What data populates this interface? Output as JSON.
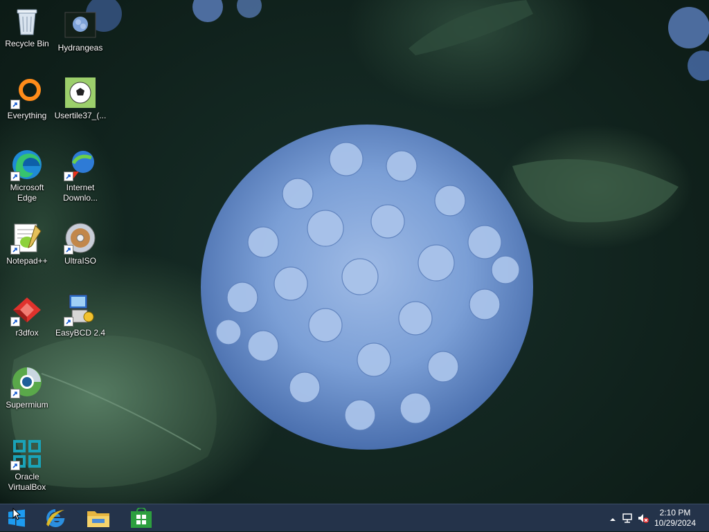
{
  "desktop": {
    "icons": [
      {
        "label": "Recycle Bin",
        "icon": "recycle-bin-icon"
      },
      {
        "label": "Hydrangeas",
        "icon": "image-file-icon"
      },
      {
        "label": "Everything",
        "icon": "everything-search-icon"
      },
      {
        "label": "Usertile37_(...",
        "icon": "soccer-ball-image-icon"
      },
      {
        "label": "Microsoft Edge",
        "icon": "edge-icon"
      },
      {
        "label": "Internet Downlo...",
        "icon": "internet-download-manager-icon"
      },
      {
        "label": "Notepad++",
        "icon": "notepad-plus-plus-icon"
      },
      {
        "label": "UltraISO",
        "icon": "disc-icon"
      },
      {
        "label": "r3dfox",
        "icon": "r3dfox-icon"
      },
      {
        "label": "EasyBCD 2.4",
        "icon": "easybcd-icon"
      },
      {
        "label": "Supermium",
        "icon": "supermium-icon"
      },
      {
        "label": "Oracle VirtualBox",
        "icon": "virtualbox-icon"
      }
    ]
  },
  "taskbar": {
    "pinned": [
      {
        "name": "start-button",
        "icon": "windows-logo-icon"
      },
      {
        "name": "internet-explorer",
        "icon": "internet-explorer-icon"
      },
      {
        "name": "file-explorer",
        "icon": "folder-icon"
      },
      {
        "name": "windows-store",
        "icon": "store-icon"
      }
    ],
    "tray": {
      "icons": [
        "show-hidden-icons-icon",
        "network-icon",
        "volume-muted-icon"
      ],
      "time": "2:10 PM",
      "date": "10/29/2024"
    }
  },
  "colors": {
    "taskbar": "#24334a",
    "store": "#2d9f3f",
    "hydrangea": "#7fa3d8"
  }
}
